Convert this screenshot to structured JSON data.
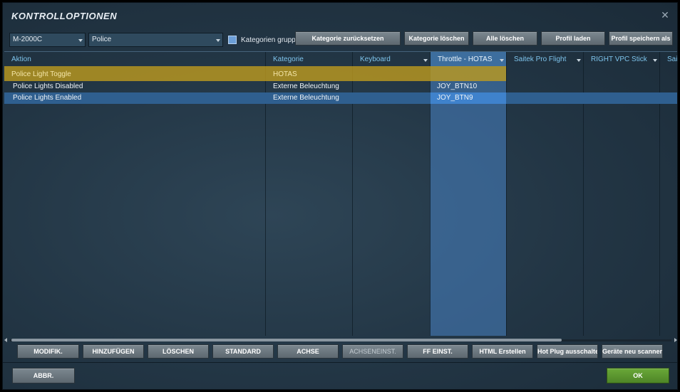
{
  "window": {
    "title": "KONTROLLOPTIONEN",
    "close_glyph": "✕"
  },
  "toolbar": {
    "aircraft_select": "M-2000C",
    "category_select": "Police",
    "group_checkbox_label": "Kategorien gruppi",
    "buttons": [
      "Kategorie zurücksetzen",
      "Kategorie löschen",
      "Alle löschen",
      "Profil laden",
      "Profil speichern als"
    ]
  },
  "grid": {
    "columns": [
      "Aktion",
      "Kategorie",
      "Keyboard",
      "Throttle - HOTAS",
      "Saitek Pro Flight",
      "RIGHT VPC Stick",
      "Saitek"
    ],
    "rows": [
      {
        "aktion": "Police Light Toggle",
        "kategorie": "HOTAS",
        "keyboard": "",
        "throttle": ""
      },
      {
        "aktion": "Police Lights Disabled",
        "kategorie": "Externe Beleuchtung",
        "keyboard": "",
        "throttle": "JOY_BTN10"
      },
      {
        "aktion": "Police Lights Enabled",
        "kategorie": "Externe Beleuchtung",
        "keyboard": "",
        "throttle": "JOY_BTN9"
      }
    ]
  },
  "bottom_buttons": [
    "MODIFIK.",
    "HINZUFÜGEN",
    "LÖSCHEN",
    "STANDARD",
    "ACHSE",
    "ACHSENEINST.",
    "FF EINST.",
    "HTML Erstellen",
    "Hot Plug ausschalten",
    "Geräte neu scannen"
  ],
  "footer": {
    "cancel": "ABBR.",
    "ok": "OK"
  },
  "colors": {
    "accent_yellow": "#be9b1e",
    "selected_blue": "#2f5f8f",
    "header_text": "#7ec4ec",
    "ok_green": "#5b9a30"
  }
}
